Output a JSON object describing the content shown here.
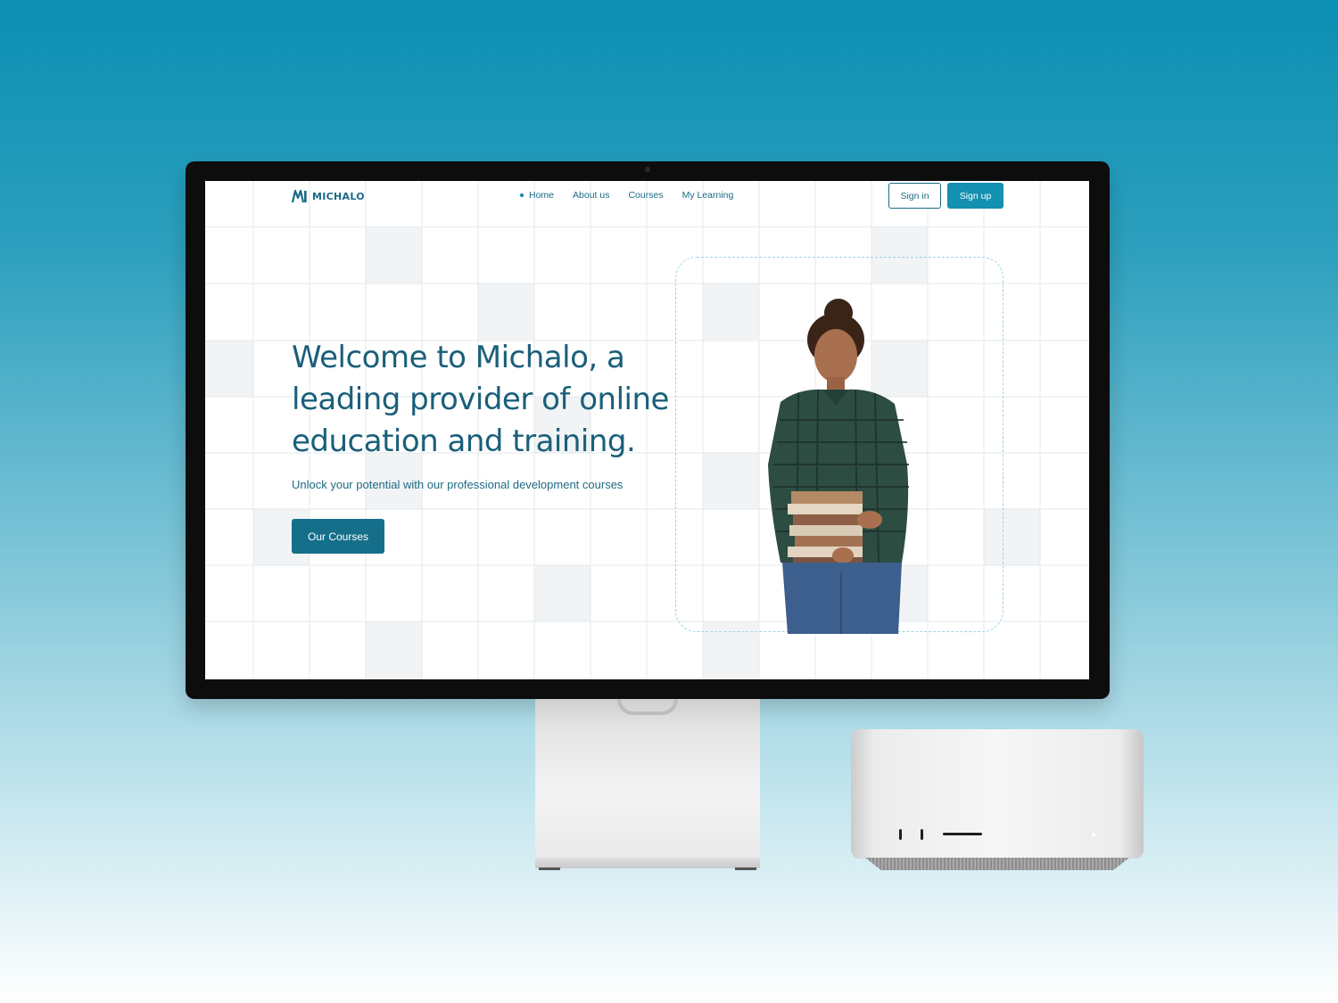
{
  "brand": {
    "name": "MICHALO",
    "color": "#1a6b86"
  },
  "nav": {
    "items": [
      {
        "label": "Home",
        "active": true
      },
      {
        "label": "About us",
        "active": false
      },
      {
        "label": "Courses",
        "active": false
      },
      {
        "label": "My Learning",
        "active": false
      }
    ],
    "signin_label": "Sign in",
    "signup_label": "Sign up"
  },
  "hero": {
    "title": "Welcome to Michalo, a leading provider of online education and training.",
    "subtitle": "Unlock your potential with our professional development courses",
    "cta_label": "Our Courses"
  },
  "colors": {
    "accent": "#1490b0",
    "heading": "#1a5f7a",
    "cta": "#156f8a"
  }
}
